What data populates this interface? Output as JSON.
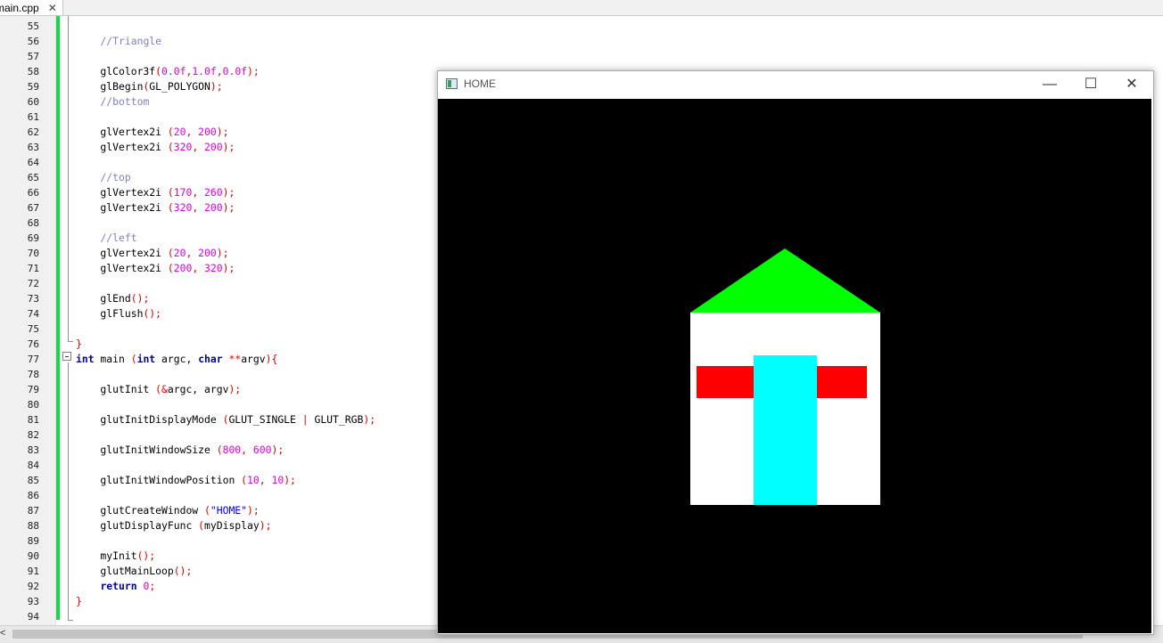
{
  "tab": {
    "label": "main.cpp",
    "close": "✕"
  },
  "window": {
    "title": "HOME",
    "minimize": "—",
    "maximize": "☐",
    "close": "✕"
  },
  "colors": {
    "roof": "#00ff00",
    "body": "#ffffff",
    "bars": "#ff0000",
    "door": "#00ffff",
    "background": "#000000",
    "change_bar": "#17d846"
  },
  "icons": {
    "tab_close": "close-icon",
    "window_app": "app-window-icon",
    "fold_toggle": "fold-minus-icon"
  },
  "scrollbar": {
    "left_arrow": "<"
  },
  "code_lines": [
    {
      "num": "55",
      "tokens": []
    },
    {
      "num": "56",
      "tokens": [
        [
          "    ",
          "n"
        ],
        [
          "//Triangle",
          "c"
        ]
      ]
    },
    {
      "num": "57",
      "tokens": []
    },
    {
      "num": "58",
      "tokens": [
        [
          "    glColor3f",
          "n"
        ],
        [
          "(",
          "o"
        ],
        [
          "0.0f",
          "p"
        ],
        [
          ",",
          "o"
        ],
        [
          "1.0f",
          "p"
        ],
        [
          ",",
          "o"
        ],
        [
          "0.0f",
          "p"
        ],
        [
          ");",
          "o"
        ]
      ]
    },
    {
      "num": "59",
      "tokens": [
        [
          "    glBegin",
          "n"
        ],
        [
          "(",
          "o"
        ],
        [
          "GL_POLYGON",
          "n"
        ],
        [
          ");",
          "o"
        ]
      ]
    },
    {
      "num": "60",
      "tokens": [
        [
          "    ",
          "n"
        ],
        [
          "//bottom",
          "c"
        ]
      ]
    },
    {
      "num": "61",
      "tokens": []
    },
    {
      "num": "62",
      "tokens": [
        [
          "    glVertex2i ",
          "n"
        ],
        [
          "(",
          "o"
        ],
        [
          "20",
          "p"
        ],
        [
          ", ",
          "o"
        ],
        [
          "200",
          "p"
        ],
        [
          ");",
          "o"
        ]
      ]
    },
    {
      "num": "63",
      "tokens": [
        [
          "    glVertex2i ",
          "n"
        ],
        [
          "(",
          "o"
        ],
        [
          "320",
          "p"
        ],
        [
          ", ",
          "o"
        ],
        [
          "200",
          "p"
        ],
        [
          ");",
          "o"
        ]
      ]
    },
    {
      "num": "64",
      "tokens": []
    },
    {
      "num": "65",
      "tokens": [
        [
          "    ",
          "n"
        ],
        [
          "//top",
          "c"
        ]
      ]
    },
    {
      "num": "66",
      "tokens": [
        [
          "    glVertex2i ",
          "n"
        ],
        [
          "(",
          "o"
        ],
        [
          "170",
          "p"
        ],
        [
          ", ",
          "o"
        ],
        [
          "260",
          "p"
        ],
        [
          ");",
          "o"
        ]
      ]
    },
    {
      "num": "67",
      "tokens": [
        [
          "    glVertex2i ",
          "n"
        ],
        [
          "(",
          "o"
        ],
        [
          "320",
          "p"
        ],
        [
          ", ",
          "o"
        ],
        [
          "200",
          "p"
        ],
        [
          ");",
          "o"
        ]
      ]
    },
    {
      "num": "68",
      "tokens": []
    },
    {
      "num": "69",
      "tokens": [
        [
          "    ",
          "n"
        ],
        [
          "//left",
          "c"
        ]
      ]
    },
    {
      "num": "70",
      "tokens": [
        [
          "    glVertex2i ",
          "n"
        ],
        [
          "(",
          "o"
        ],
        [
          "20",
          "p"
        ],
        [
          ", ",
          "o"
        ],
        [
          "200",
          "p"
        ],
        [
          ");",
          "o"
        ]
      ]
    },
    {
      "num": "71",
      "tokens": [
        [
          "    glVertex2i ",
          "n"
        ],
        [
          "(",
          "o"
        ],
        [
          "200",
          "p"
        ],
        [
          ", ",
          "o"
        ],
        [
          "320",
          "p"
        ],
        [
          ");",
          "o"
        ]
      ]
    },
    {
      "num": "72",
      "tokens": []
    },
    {
      "num": "73",
      "tokens": [
        [
          "    glEnd",
          "n"
        ],
        [
          "();",
          "o"
        ]
      ]
    },
    {
      "num": "74",
      "tokens": [
        [
          "    glFlush",
          "n"
        ],
        [
          "();",
          "o"
        ]
      ]
    },
    {
      "num": "75",
      "tokens": []
    },
    {
      "num": "76",
      "tokens": [
        [
          "}",
          "o"
        ]
      ]
    },
    {
      "num": "77",
      "tokens": [
        [
          "int",
          "k"
        ],
        [
          " main ",
          "n"
        ],
        [
          "(",
          "o"
        ],
        [
          "int",
          "k"
        ],
        [
          " argc, ",
          "n"
        ],
        [
          "char",
          "k"
        ],
        [
          " ",
          "n"
        ],
        [
          "**",
          "o"
        ],
        [
          "argv",
          "n"
        ],
        [
          "){",
          "o"
        ]
      ]
    },
    {
      "num": "78",
      "tokens": []
    },
    {
      "num": "79",
      "tokens": [
        [
          "    glutInit ",
          "n"
        ],
        [
          "(&",
          "o"
        ],
        [
          "argc, argv",
          "n"
        ],
        [
          ");",
          "o"
        ]
      ]
    },
    {
      "num": "80",
      "tokens": []
    },
    {
      "num": "81",
      "tokens": [
        [
          "    glutInitDisplayMode ",
          "n"
        ],
        [
          "(",
          "o"
        ],
        [
          "GLUT_SINGLE ",
          "n"
        ],
        [
          "|",
          "o"
        ],
        [
          " GLUT_RGB",
          "n"
        ],
        [
          ");",
          "o"
        ]
      ]
    },
    {
      "num": "82",
      "tokens": []
    },
    {
      "num": "83",
      "tokens": [
        [
          "    glutInitWindowSize ",
          "n"
        ],
        [
          "(",
          "o"
        ],
        [
          "800",
          "p"
        ],
        [
          ", ",
          "o"
        ],
        [
          "600",
          "p"
        ],
        [
          ");",
          "o"
        ]
      ]
    },
    {
      "num": "84",
      "tokens": []
    },
    {
      "num": "85",
      "tokens": [
        [
          "    glutInitWindowPosition ",
          "n"
        ],
        [
          "(",
          "o"
        ],
        [
          "10",
          "p"
        ],
        [
          ", ",
          "o"
        ],
        [
          "10",
          "p"
        ],
        [
          ");",
          "o"
        ]
      ]
    },
    {
      "num": "86",
      "tokens": []
    },
    {
      "num": "87",
      "tokens": [
        [
          "    glutCreateWindow ",
          "n"
        ],
        [
          "(",
          "o"
        ],
        [
          "\"HOME\"",
          "s"
        ],
        [
          ");",
          "o"
        ]
      ]
    },
    {
      "num": "88",
      "tokens": [
        [
          "    glutDisplayFunc ",
          "n"
        ],
        [
          "(",
          "o"
        ],
        [
          "myDisplay",
          "n"
        ],
        [
          ");",
          "o"
        ]
      ]
    },
    {
      "num": "89",
      "tokens": []
    },
    {
      "num": "90",
      "tokens": [
        [
          "    myInit",
          "n"
        ],
        [
          "();",
          "o"
        ]
      ]
    },
    {
      "num": "91",
      "tokens": [
        [
          "    glutMainLoop",
          "n"
        ],
        [
          "();",
          "o"
        ]
      ]
    },
    {
      "num": "92",
      "tokens": [
        [
          "    ",
          "n"
        ],
        [
          "return",
          "k"
        ],
        [
          " ",
          "n"
        ],
        [
          "0",
          "p"
        ],
        [
          ";",
          "o"
        ]
      ]
    },
    {
      "num": "93",
      "tokens": [
        [
          "}",
          "o"
        ]
      ]
    },
    {
      "num": "94",
      "tokens": []
    }
  ]
}
